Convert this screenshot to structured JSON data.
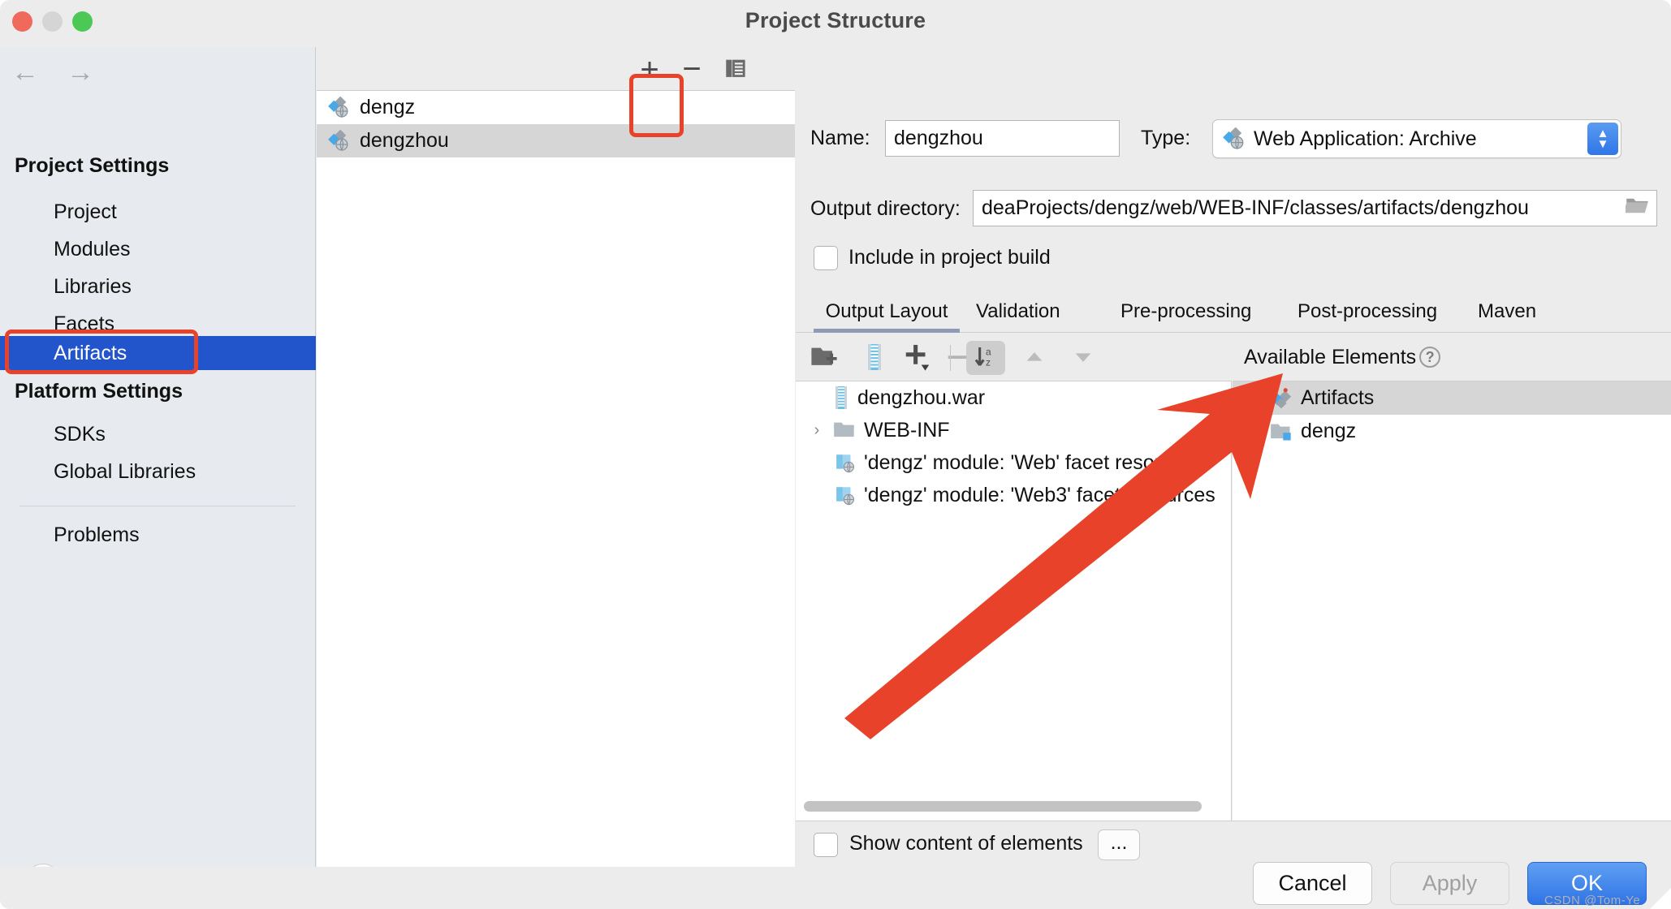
{
  "window": {
    "title": "Project Structure",
    "traffic_lights": [
      "close",
      "minimize",
      "zoom"
    ]
  },
  "sidebar": {
    "groups": [
      {
        "label": "Project Settings",
        "items": [
          "Project",
          "Modules",
          "Libraries",
          "Facets",
          "Artifacts"
        ]
      },
      {
        "label": "Platform Settings",
        "items": [
          "SDKs",
          "Global Libraries"
        ]
      }
    ],
    "selected_item": "Artifacts",
    "problems_label": "Problems",
    "help_glyph": "?"
  },
  "artifacts_panel": {
    "toolbar": {
      "add_label": "+",
      "remove_label": "−",
      "copy_name": "copy-icon"
    },
    "items": [
      {
        "label": "dengz",
        "selected": false
      },
      {
        "label": "dengzhou",
        "selected": true
      }
    ]
  },
  "detail": {
    "name_label": "Name:",
    "name_value": "dengzhou",
    "type_label": "Type:",
    "type_value": "Web Application: Archive",
    "output_dir_label": "Output directory:",
    "output_dir_value": "deaProjects/dengz/web/WEB-INF/classes/artifacts/dengzhou",
    "include_in_build_label": "Include in project build",
    "include_in_build_checked": false,
    "tabs": [
      {
        "label": "Output Layout",
        "active": true
      },
      {
        "label": "Validation",
        "active": false
      },
      {
        "label": "Pre-processing",
        "active": false
      },
      {
        "label": "Post-processing",
        "active": false
      },
      {
        "label": "Maven",
        "active": false
      }
    ],
    "layout_toolbar": [
      {
        "name": "add-directory-icon"
      },
      {
        "name": "add-archive-icon"
      },
      {
        "name": "add-plus-dropdown-icon"
      },
      {
        "name": "remove-icon"
      },
      {
        "name": "sort-az-icon"
      },
      {
        "name": "move-up-icon"
      },
      {
        "name": "move-down-icon"
      }
    ],
    "output_tree": [
      {
        "label": "dengzhou.war",
        "icon": "archive-icon",
        "indent": 0,
        "expandable": false
      },
      {
        "label": "WEB-INF",
        "icon": "folder-icon",
        "indent": 0,
        "expandable": true
      },
      {
        "label": "'dengz' module: 'Web' facet resources",
        "icon": "facet-resource-icon",
        "indent": 1,
        "expandable": false
      },
      {
        "label": "'dengz' module: 'Web3' facet resources",
        "icon": "facet-resource-icon",
        "indent": 1,
        "expandable": false
      }
    ],
    "available": {
      "title": "Available Elements",
      "help_glyph": "?",
      "items": [
        {
          "label": "Artifacts",
          "icon": "artifacts-icon",
          "expandable": true,
          "selected": true
        },
        {
          "label": "dengz",
          "icon": "module-folder-icon",
          "expandable": true,
          "selected": false
        }
      ]
    },
    "show_content_label": "Show content of elements",
    "show_content_checked": false,
    "ellipsis_label": "..."
  },
  "footer": {
    "cancel_label": "Cancel",
    "apply_label": "Apply",
    "ok_label": "OK",
    "watermark": "CSDN @Tom-Ye"
  },
  "colors": {
    "accent_blue": "#2f74e6",
    "selection_blue": "#2255cc",
    "annotation_red": "#e8432a",
    "sidebar_bg": "#e7eaee",
    "panel_bg": "#ececec"
  }
}
